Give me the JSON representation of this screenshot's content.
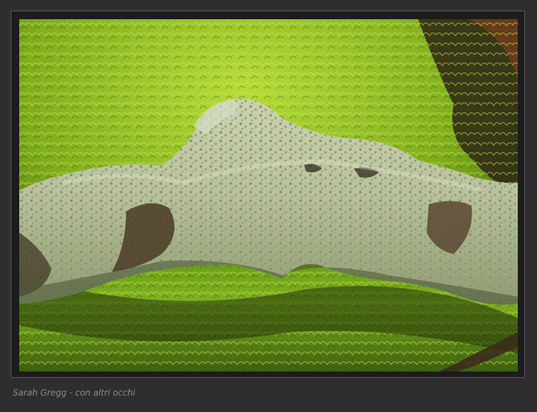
{
  "caption": {
    "text": "Sarah Gregg - con altri occhi"
  },
  "colors": {
    "background": "#2e2e30",
    "frame": "#1c1c1d",
    "caption": "#8a8a8c",
    "moss_light": "#a6cf2a",
    "moss_dark": "#3f5a12",
    "lichen": "#b9c6a0"
  }
}
